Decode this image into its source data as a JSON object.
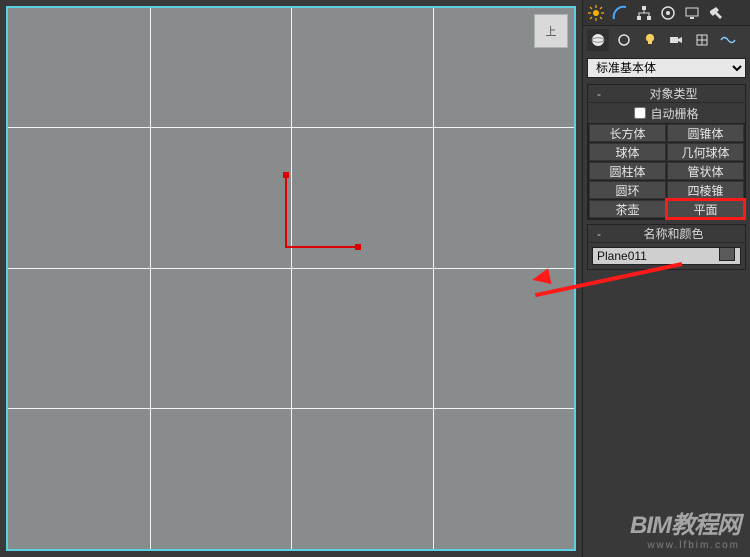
{
  "viewport": {
    "cube_label": "上"
  },
  "top_icons": [
    "sun",
    "arc",
    "hierarchy",
    "cylinder",
    "display",
    "hammer"
  ],
  "tabs": [
    "sphere",
    "sphere2",
    "link",
    "skull",
    "cone",
    "wave"
  ],
  "dropdown": {
    "selected": "标准基本体"
  },
  "object_type": {
    "title": "对象类型",
    "autogrid_label": "自动栅格",
    "autogrid_checked": false,
    "buttons": [
      {
        "label": "长方体"
      },
      {
        "label": "圆锥体"
      },
      {
        "label": "球体"
      },
      {
        "label": "几何球体"
      },
      {
        "label": "圆柱体"
      },
      {
        "label": "管状体"
      },
      {
        "label": "圆环"
      },
      {
        "label": "四棱锥"
      },
      {
        "label": "茶壶"
      },
      {
        "label": "平面",
        "selected": true
      }
    ]
  },
  "name_color": {
    "title": "名称和颜色",
    "value": "Plane011"
  },
  "watermark": {
    "line1": "BIM教程网",
    "line2": "www.lfbim.com"
  }
}
